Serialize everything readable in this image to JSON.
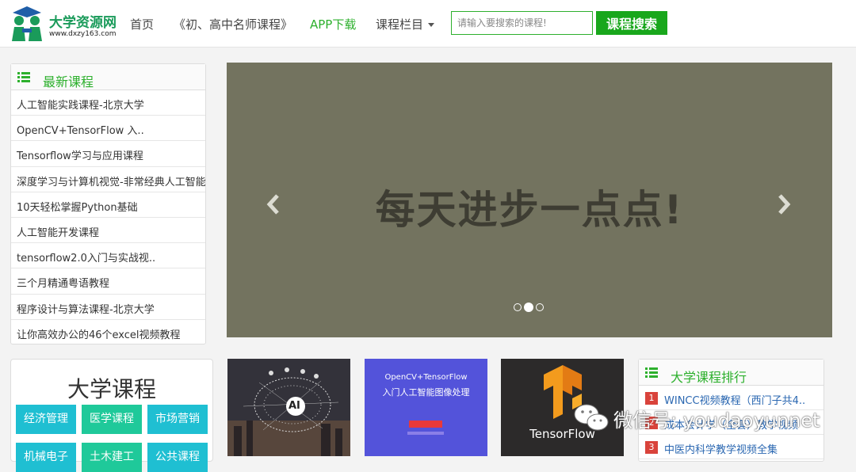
{
  "header": {
    "logo_title": "大学资源网",
    "logo_url": "www.dxzy163.com",
    "nav": {
      "home": "首页",
      "teachers": "《初、高中名师课程》",
      "app": "APP下载",
      "columns": "课程栏目"
    },
    "search": {
      "placeholder": "请输入要搜索的课程!",
      "button": "课程搜索"
    },
    "accent_color": "#2db02d"
  },
  "latest": {
    "title": "最新课程",
    "items": [
      "人工智能实践课程-北京大学",
      "OpenCV+TensorFlow 入..",
      "Tensorflow学习与应用课程",
      "深度学习与计算机视觉-非常经典人工智能..",
      "10天轻松掌握Python基础",
      "人工智能开发课程",
      "tensorflow2.0入门与实战视..",
      "三个月精通粤语教程",
      "程序设计与算法课程-北京大学",
      "让你高效办公的46个excel视频教程"
    ]
  },
  "slider": {
    "text": "每天进步一点点!",
    "slide_count": 3,
    "active_slide": 2
  },
  "categories": {
    "title": "大学课程",
    "buttons": [
      "经济管理",
      "医学课程",
      "市场营销",
      "机械电子",
      "土木建工",
      "公共课程"
    ]
  },
  "thumbs": {
    "ai_label": "AI",
    "opencv_title": "OpenCV+TensorFlow",
    "opencv_subtitle": "入门人工智能图像处理",
    "tensorflow_label": "TensorFlow"
  },
  "ranking": {
    "title": "大学课程排行",
    "items": [
      {
        "rank": "1",
        "text": "WINCC视频教程（西门子共4.."
      },
      {
        "rank": "2",
        "text": "成本会计学（全套）教学视频"
      },
      {
        "rank": "3",
        "text": "中医内科学教学视频全集"
      }
    ]
  },
  "watermark": {
    "text": "微信号: youdaoyunnet"
  }
}
